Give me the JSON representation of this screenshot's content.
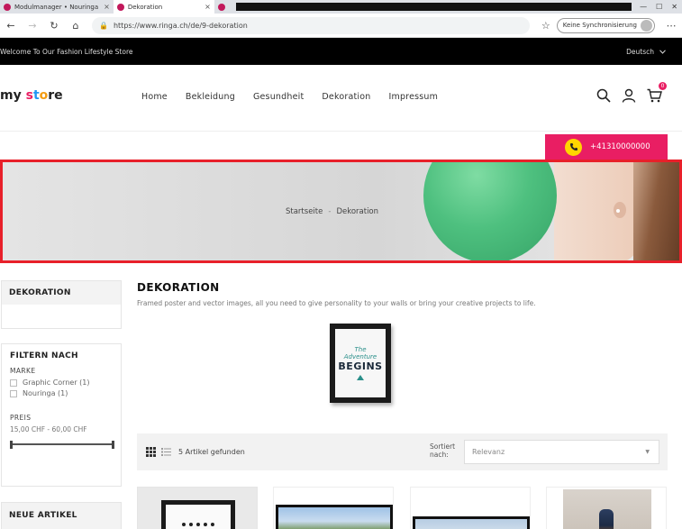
{
  "browser": {
    "tabs": [
      {
        "title": "Modulmanager • Nouringa",
        "favicon_color": "#c2185b",
        "active": false
      },
      {
        "title": "Dekoration",
        "favicon_color": "#c2185b",
        "active": true
      },
      {
        "title": "",
        "favicon_color": "#c2185b",
        "active": false
      }
    ],
    "url": "https://www.ringa.ch/de/9-dekoration",
    "sync_label": "Keine Synchronisierung",
    "window_controls": [
      "—",
      "☐",
      "✕"
    ]
  },
  "topstrip": {
    "welcome": "Welcome To Our Fashion Lifestyle Store",
    "language": "Deutsch"
  },
  "header": {
    "logo_parts": [
      "my ",
      "s",
      "t",
      "o",
      "re"
    ],
    "nav": [
      "Home",
      "Bekleidung",
      "Gesundheit",
      "Dekoration",
      "Impressum"
    ],
    "cart_count": "0",
    "phone": "+41310000000"
  },
  "banner": {
    "breadcrumb_home": "Startseite",
    "breadcrumb_sep": "-",
    "breadcrumb_current": "Dekoration"
  },
  "sidebar": {
    "category_title": "DEKORATION",
    "filter_title": "FILTERN NACH",
    "brand_label": "MARKE",
    "brands": [
      "Graphic Corner (1)",
      "Nouringa (1)"
    ],
    "price_label": "PREIS",
    "price_range": "15,00 CHF - 60,00 CHF",
    "new_title": "NEUE ARTIKEL"
  },
  "main": {
    "title": "DEKORATION",
    "description": "Framed poster and vector images, all you need to give personality to your walls or bring your creative projects to life.",
    "poster_top": "The",
    "poster_mid": "Adventure",
    "poster_big": "BEGINS",
    "count_text": "5 Artikel gefunden",
    "sort_label": "Sortiert nach:",
    "sort_value": "Relevanz"
  },
  "colors": {
    "accent": "#e91e63",
    "phone_icon": "#ffd600",
    "banner_border": "#e8202a"
  }
}
